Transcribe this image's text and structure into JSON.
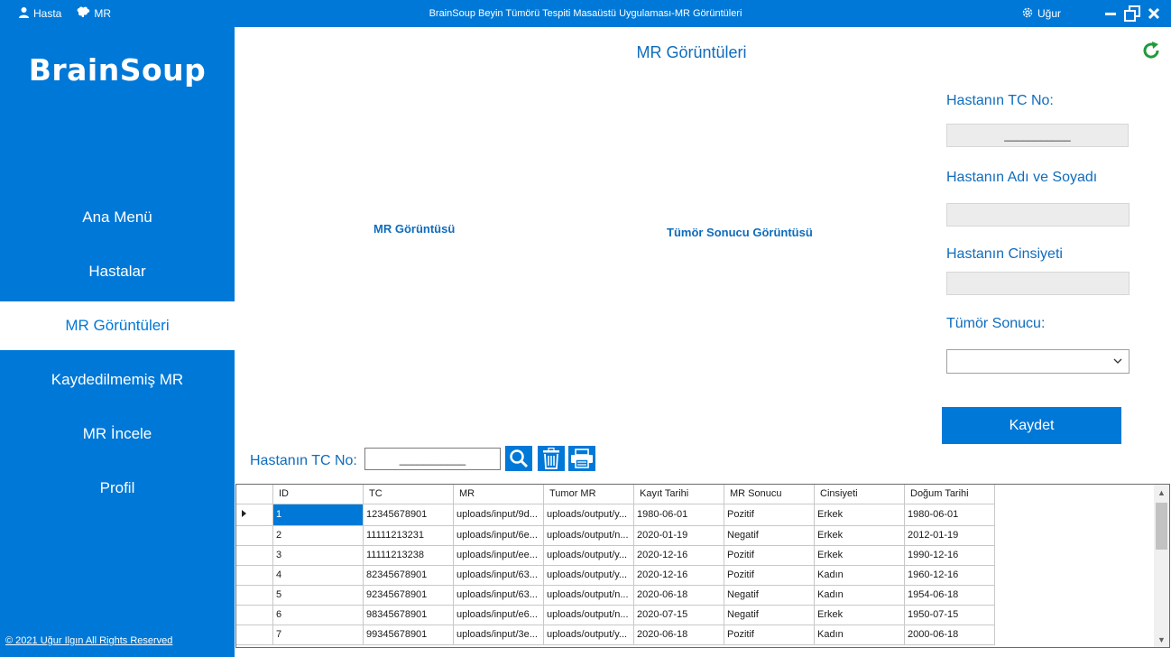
{
  "titlebar": {
    "menu": [
      {
        "label": "Hasta",
        "icon": "user-icon"
      },
      {
        "label": "MR",
        "icon": "brain-icon"
      }
    ],
    "title": "BrainSoup Beyin Tümörü Tespiti Masaüstü Uygulaması-MR Görüntüleri",
    "user": "Uğur"
  },
  "sidebar": {
    "logo": "BrainSoup",
    "items": [
      {
        "label": "Ana Menü"
      },
      {
        "label": "Hastalar"
      },
      {
        "label": "MR Görüntüleri"
      },
      {
        "label": "Kaydedilmemiş MR"
      },
      {
        "label": "MR İncele"
      },
      {
        "label": "Profil"
      }
    ],
    "active_index": 2,
    "footer": "© 2021 Uğur Ilgın All Rights Reserved"
  },
  "main": {
    "title": "MR Görüntüleri",
    "mr_image_label": "MR Görüntüsü",
    "tumor_image_label": "Tümör Sonucu Görüntüsü"
  },
  "form": {
    "tc_label": "Hastanın TC No:",
    "tc_value": "___________",
    "name_label": "Hastanın Adı ve Soyadı",
    "name_value": "",
    "gender_label": "Hastanın Cinsiyeti",
    "gender_value": "",
    "tumor_label": "Tümör Sonucu:",
    "tumor_value": "",
    "save_label": "Kaydet"
  },
  "search": {
    "label": "Hastanın TC No:",
    "value": "___________"
  },
  "grid": {
    "columns": [
      "ID",
      "TC",
      "MR",
      "Tumor MR",
      "Kayıt Tarihi",
      "MR Sonucu",
      "Cinsiyeti",
      "Doğum Tarihi"
    ],
    "rows": [
      [
        "1",
        "12345678901",
        "uploads/input/9d...",
        "uploads/output/y...",
        "1980-06-01",
        "Pozitif",
        "Erkek",
        "1980-06-01"
      ],
      [
        "2",
        "11111213231",
        "uploads/input/6e...",
        "uploads/output/n...",
        "2020-01-19",
        "Negatif",
        "Erkek",
        "2012-01-19"
      ],
      [
        "3",
        "11111213238",
        "uploads/input/ee...",
        "uploads/output/y...",
        "2020-12-16",
        "Pozitif",
        "Erkek",
        "1990-12-16"
      ],
      [
        "4",
        "82345678901",
        "uploads/input/63...",
        "uploads/output/y...",
        "2020-12-16",
        "Pozitif",
        "Kadın",
        "1960-12-16"
      ],
      [
        "5",
        "92345678901",
        "uploads/input/63...",
        "uploads/output/n...",
        "2020-06-18",
        "Negatif",
        "Kadın",
        "1954-06-18"
      ],
      [
        "6",
        "98345678901",
        "uploads/input/e6...",
        "uploads/output/n...",
        "2020-07-15",
        "Negatif",
        "Erkek",
        "1950-07-15"
      ],
      [
        "7",
        "99345678901",
        "uploads/input/3e...",
        "uploads/output/y...",
        "2020-06-18",
        "Pozitif",
        "Kadın",
        "2000-06-18"
      ]
    ],
    "selected_row": 0
  },
  "colors": {
    "accent": "#0078d7",
    "refresh": "#1e9b3a"
  }
}
